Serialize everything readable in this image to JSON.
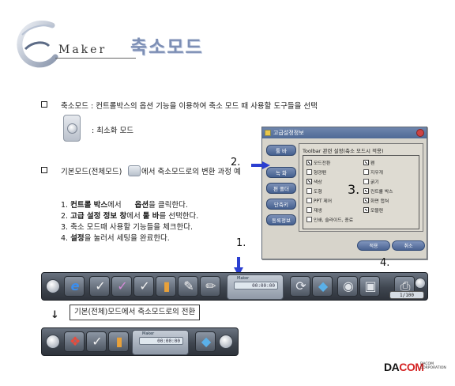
{
  "header": {
    "logo_letter": "E",
    "logo_word": "Maker",
    "title": "축소모드"
  },
  "section1": {
    "text": "축소모드 : 컨트롤박스의 옵션 기능을 이용하여 축소 모드 때 사용할 도구들을 선택",
    "minimize_label": ": 최소화 모드"
  },
  "section2": {
    "text_a": "기본모드(전체모드)",
    "text_b": "에서 축소모드로의 변환 과정 예",
    "steps": [
      {
        "n": "1.",
        "bold": "컨트롤 박스",
        "mid": "에서",
        "bold2": "옵션",
        "rest": "을 클릭한다."
      },
      {
        "n": "2.",
        "bold": "고급 설정 정보 창",
        "mid": "에서",
        "bold2": "툴 바",
        "rest": "를 선택한다."
      },
      {
        "n": "3.",
        "text": "축소 모드때 사용할 기능들을 체크한다."
      },
      {
        "n": "4.",
        "bold": "설정",
        "rest": "을 눌러서 세팅을 완료한다."
      }
    ]
  },
  "dialog": {
    "title": "고급설정정보",
    "panel_heading": "Toolbar 관련 설정(축소 모드시 적용)",
    "side_buttons": [
      "툴 바",
      "녹 화",
      "편 폴더",
      "단축키",
      "동록정보"
    ],
    "checkboxes_left": [
      {
        "label": "모드전환",
        "checked": true
      },
      {
        "label": "형광펜",
        "checked": false
      },
      {
        "label": "색상",
        "checked": true
      },
      {
        "label": "도형",
        "checked": false
      },
      {
        "label": "PPT 제어",
        "checked": false
      },
      {
        "label": "재생",
        "checked": false
      },
      {
        "label": "인쇄, 슬라이드, 종료",
        "checked": false
      }
    ],
    "checkboxes_right": [
      {
        "label": "펜",
        "checked": true
      },
      {
        "label": "지우개",
        "checked": false
      },
      {
        "label": "굵기",
        "checked": false
      },
      {
        "label": "컨트롤 박스",
        "checked": true
      },
      {
        "label": "화면 캡쳐",
        "checked": true
      },
      {
        "label": "모블렌",
        "checked": true
      }
    ],
    "ok_label": "적용",
    "cancel_label": "취소"
  },
  "callouts": {
    "one": "1.",
    "two": "2.",
    "three": "3.",
    "four": "4."
  },
  "control_box": {
    "label": "Maker",
    "display": "00:00:00"
  },
  "page_counter": "1/100",
  "caption": "기본(전체)모드에서 축소모드로의 전환",
  "footer": {
    "logo_a": "DA",
    "logo_b": "COM",
    "sub1": "DACOM",
    "sub2": "CORPORATION"
  },
  "colors": {
    "title_accent": "#7d8fb5",
    "toolbar": "#3f4650",
    "callout_arrow": "#2b3fd1",
    "brand_red": "#d42222"
  }
}
